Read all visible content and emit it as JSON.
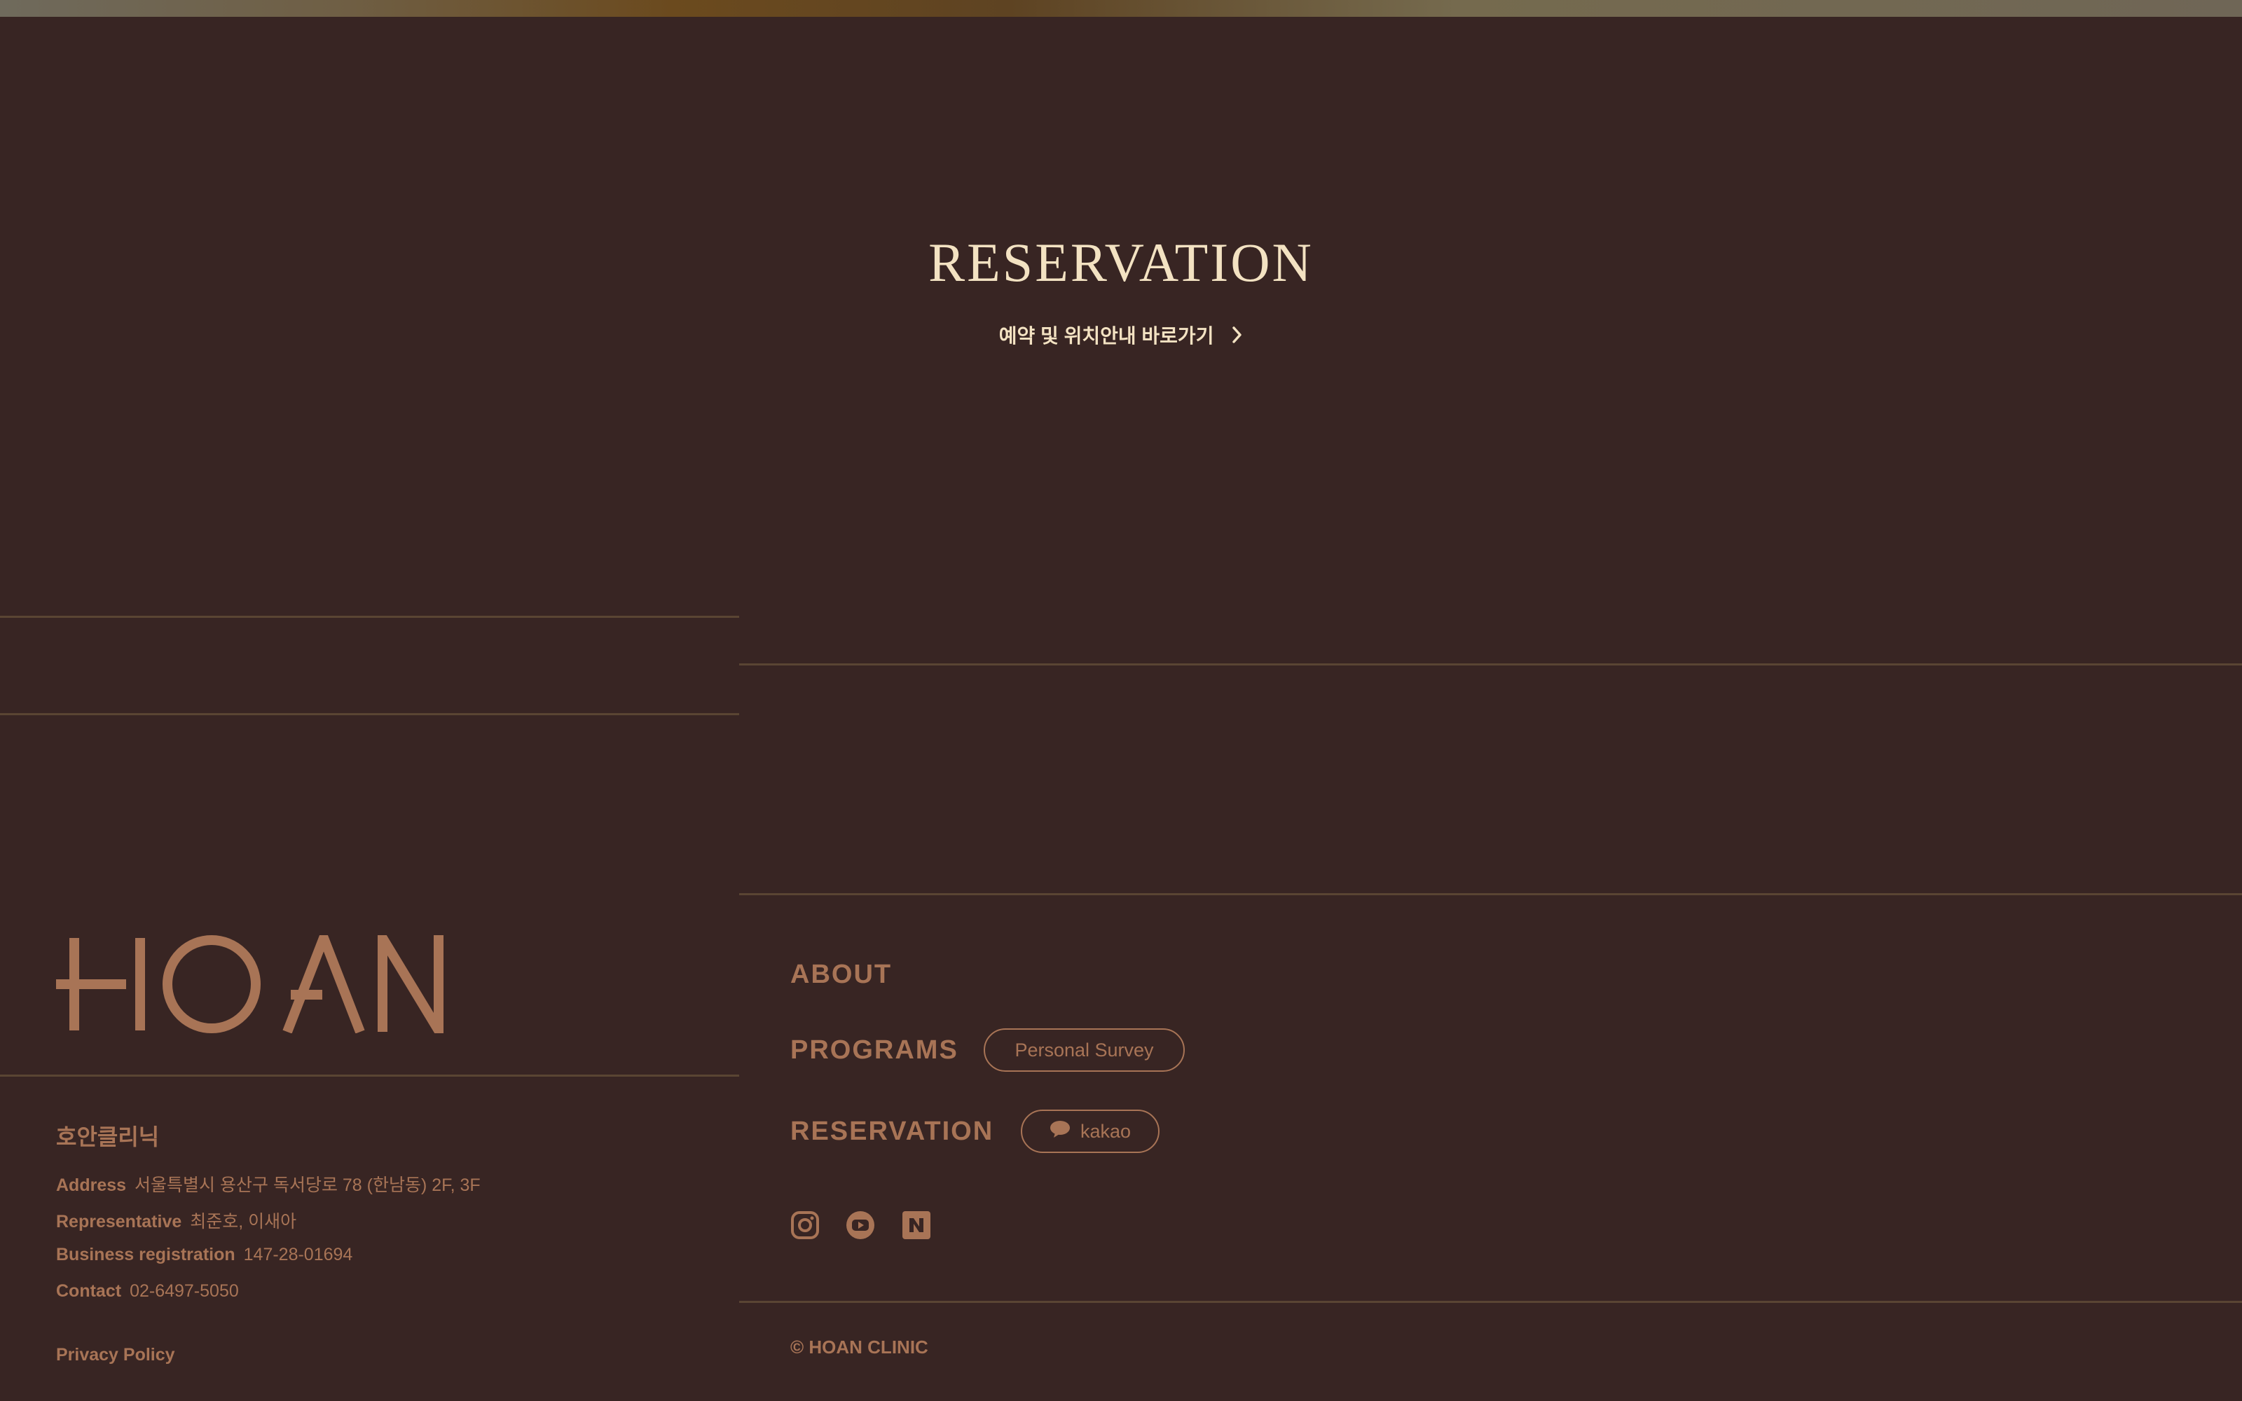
{
  "reservation": {
    "title": "RESERVATION",
    "link_label": "예약 및 위치안내 바로가기"
  },
  "brand": {
    "logo_text": "HOAN",
    "clinic_name": "호안클리닉"
  },
  "info": [
    {
      "key": "Address",
      "value": "서울특별시 용산구 독서당로 78 (한남동) 2F, 3F"
    },
    {
      "key": "Representative",
      "value": "최준호, 이새아"
    },
    {
      "key": "Business registration",
      "value": "147-28-01694"
    },
    {
      "key": "Contact",
      "value": "02-6497-5050"
    }
  ],
  "privacy_label": "Privacy Policy",
  "nav": {
    "about": "ABOUT",
    "programs": "PROGRAMS",
    "programs_pill": "Personal Survey",
    "reservation": "RESERVATION",
    "reservation_pill": "kakao"
  },
  "social": [
    "instagram-icon",
    "youtube-icon",
    "naver-blog-icon"
  ],
  "copyright": "© HOAN CLINIC",
  "colors": {
    "background": "#382523",
    "accent": "#a87456",
    "cream": "#f3e2c2",
    "divider": "#5a4533"
  }
}
